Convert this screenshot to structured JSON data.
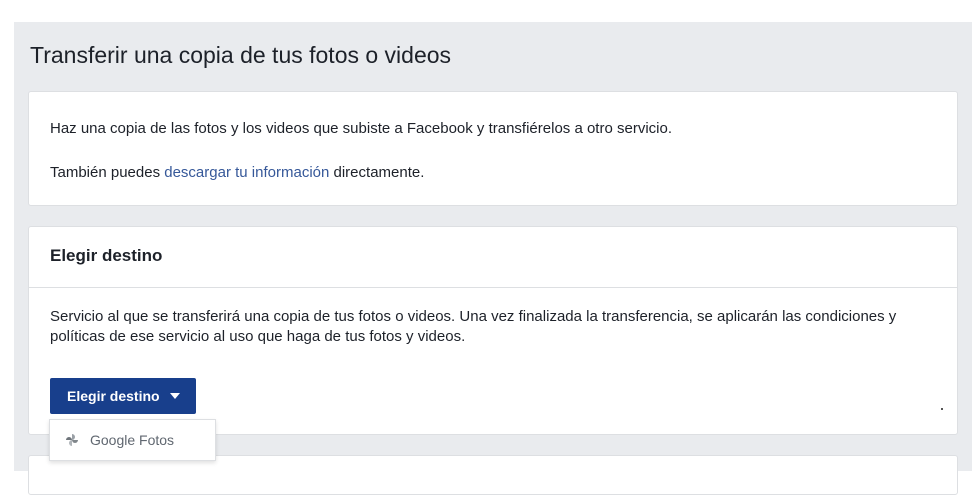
{
  "page": {
    "title": "Transferir una copia de tus fotos o videos"
  },
  "intro": {
    "line1": "Haz una copia de las fotos y los videos que subiste a Facebook y transfiérelos a otro servicio.",
    "line2_before": "También puedes ",
    "line2_link": "descargar tu información",
    "line2_after": " directamente."
  },
  "destination": {
    "heading": "Elegir destino",
    "description": "Servicio al que se transferirá una copia de tus fotos o videos. Una vez finalizada la transferencia, se aplicarán las condiciones y políticas de ese servicio al uso que haga de tus fotos y videos.",
    "button_label": "Elegir destino",
    "button_icon": "caret-down-icon",
    "options": [
      {
        "label": "Google Fotos",
        "icon": "google-photos-icon"
      }
    ]
  },
  "colors": {
    "background": "#e9ebee",
    "card": "#ffffff",
    "primary_button": "#183f8c",
    "link": "#365899",
    "text": "#1d2129"
  }
}
